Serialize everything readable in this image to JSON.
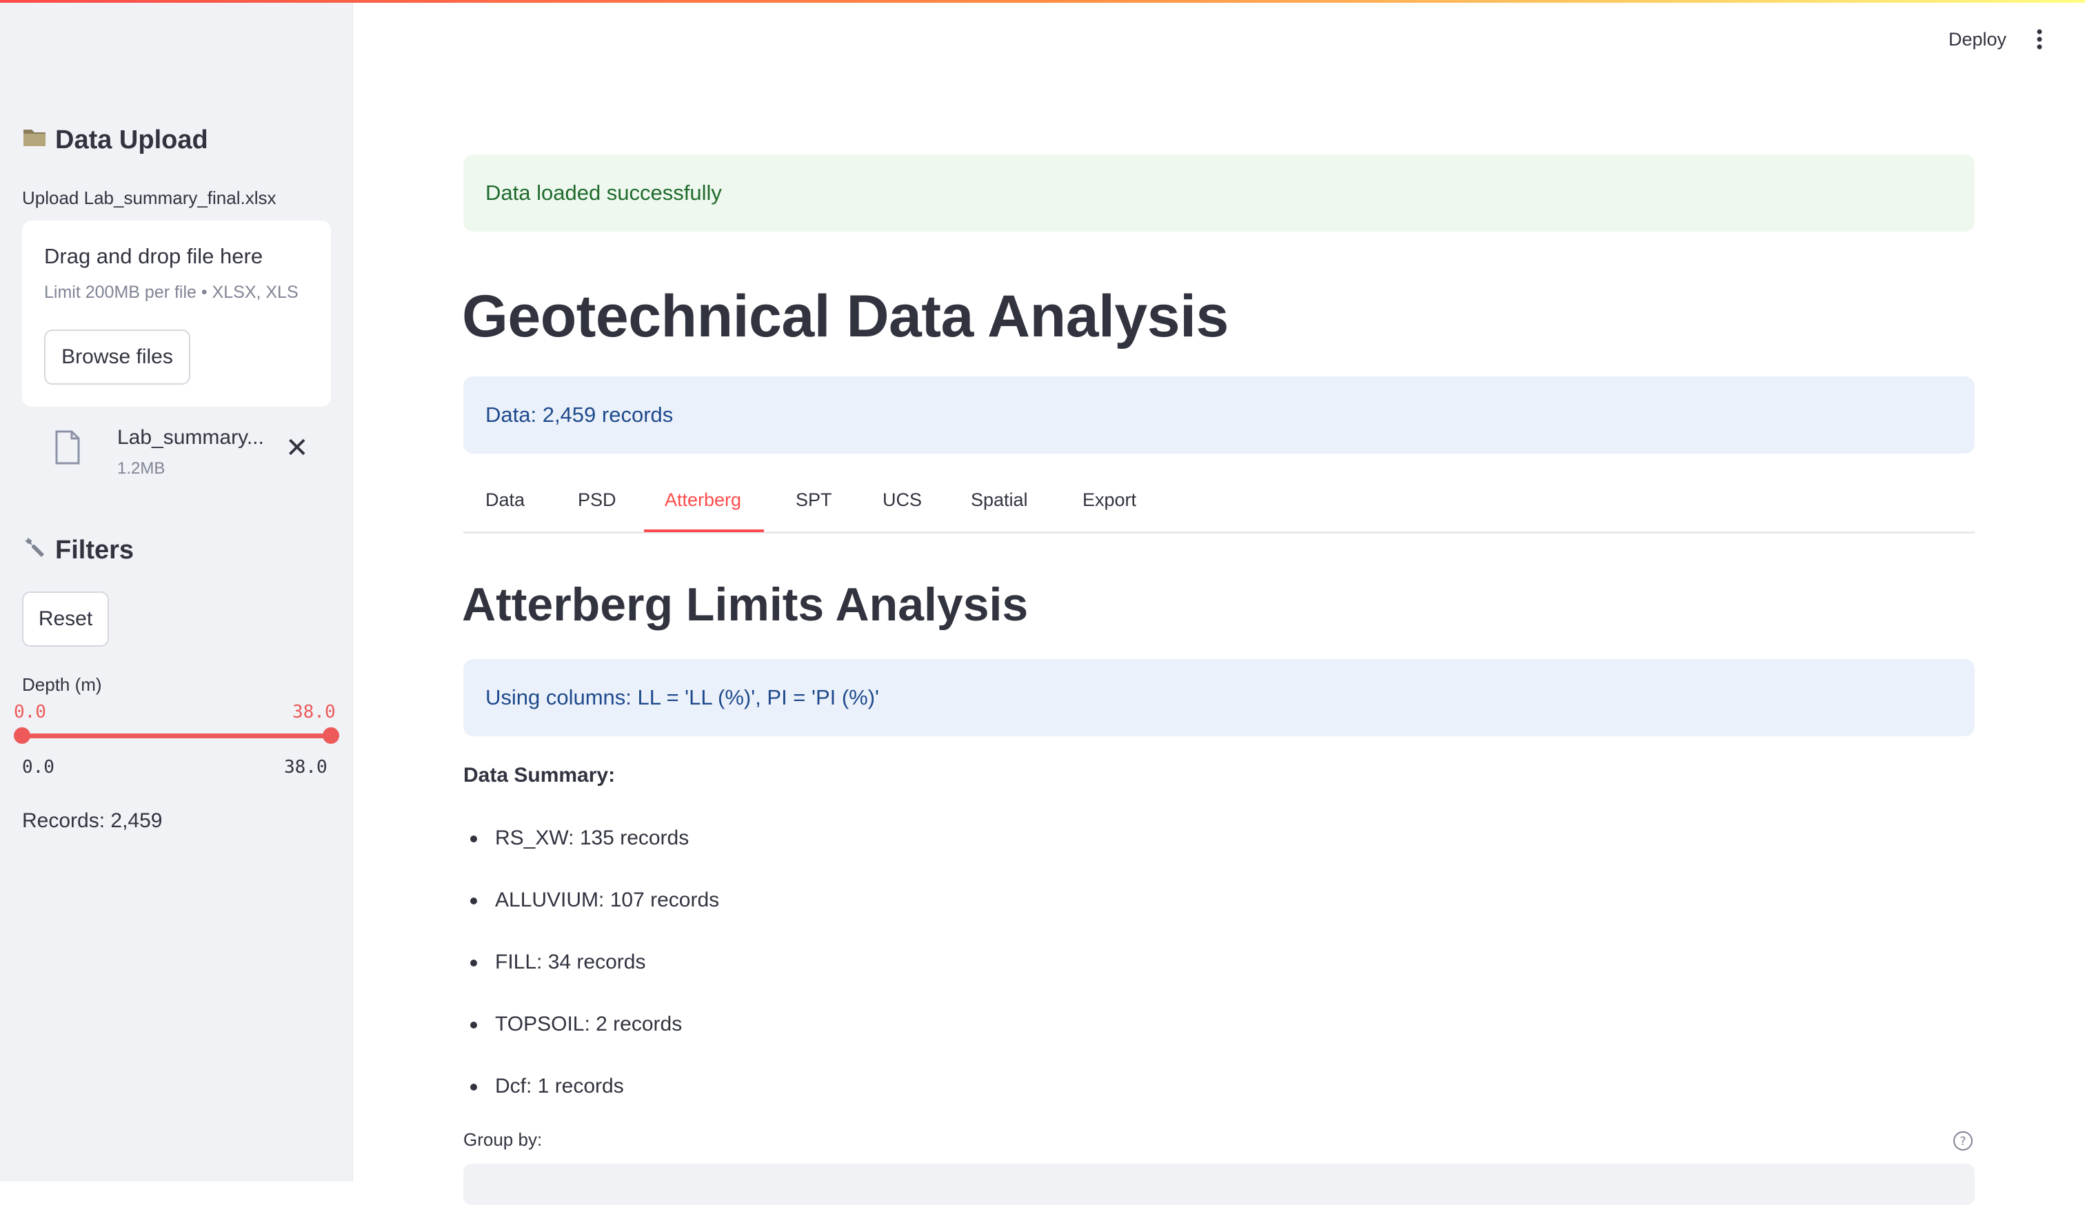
{
  "sidebar": {
    "upload_header": "Data Upload",
    "upload_icon": "folder-icon",
    "upload_label": "Upload Lab_summary_final.xlsx",
    "dropzone_title": "Drag and drop file here",
    "dropzone_hint": "Limit 200MB per file • XLSX, XLS",
    "browse_label": "Browse files",
    "file_name": "Lab_summary...",
    "file_size": "1.2MB",
    "filters_header": "Filters",
    "filters_icon": "wrench-icon",
    "reset_label": "Reset",
    "depth_label": "Depth (m)",
    "depth_min_value": "0.0",
    "depth_max_value": "38.0",
    "depth_range_min": "0.0",
    "depth_range_max": "38.0",
    "records": "Records: 2,459"
  },
  "header": {
    "deploy_label": "Deploy",
    "menu_icon": "kebab-menu-icon"
  },
  "main": {
    "success_message": "Data loaded successfully",
    "title": "Geotechnical Data Analysis",
    "data_info": "Data: 2,459 records",
    "tabs": [
      {
        "label": "Data",
        "active": false
      },
      {
        "label": "PSD",
        "active": false
      },
      {
        "label": "Atterberg",
        "active": true
      },
      {
        "label": "SPT",
        "active": false
      },
      {
        "label": "UCS",
        "active": false
      },
      {
        "label": "Spatial",
        "active": false
      },
      {
        "label": "Export",
        "active": false
      }
    ],
    "section_title": "Atterberg Limits Analysis",
    "columns_info": "Using columns: LL = 'LL (%)', PI = 'PI (%)'",
    "summary_title": "Data Summary:",
    "summary_items": [
      "RS_XW: 135 records",
      "ALLUVIUM: 107 records",
      "FILL: 34 records",
      "TOPSOIL: 2 records",
      "Dcf: 1 records"
    ],
    "group_by_label": "Group by:"
  },
  "colors": {
    "accent": "#ff4b4b",
    "sidebar_bg": "#f0f2f6",
    "success_bg": "#eef8ee",
    "info_bg": "#ebf1fb"
  }
}
